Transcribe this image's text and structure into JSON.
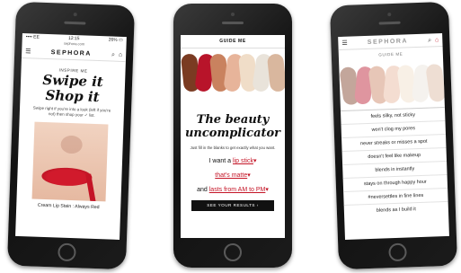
{
  "phone1": {
    "status": {
      "carrier": "•••• EE",
      "time": "12:15",
      "battery": "26% ▭"
    },
    "url": "sephora.com",
    "brand": "SEPHORA",
    "section_title": "INSPIRE ME",
    "title_line1": "Swipe it",
    "title_line2": "Shop it",
    "subtext": "Swipe right if you're into a look (left if you're not) then shop your ✓ list.",
    "product_caption": "Cream Lip Stain : Always Red"
  },
  "phone2": {
    "header": "GUIDE ME",
    "title_line1": "The beauty",
    "title_line2": "uncomplicator",
    "hint": "Just fill in the blanks to get exactly what you want.",
    "line1_prefix": "I want a",
    "line1_blank": "lip stick",
    "line2_blank": "that's matte",
    "line3_prefix": "and",
    "line3_blank": "lasts from AM to PM",
    "arrow": "▾",
    "button_label": "SEE YOUR RESULTS ›",
    "swatch_colors": [
      "#7a3b22",
      "#b8142a",
      "#c9825f",
      "#e7b49a",
      "#f0ddc8",
      "#e9e3da",
      "#d9b79e"
    ]
  },
  "phone3": {
    "brand": "SEPHORA",
    "header": "GUIDE ME",
    "options": [
      "feels silky, not sticky",
      "won't clog my pores",
      "never streaks or misses a spot",
      "doesn't feel like makeup",
      "blends in instantly",
      "stays on through happy hour",
      "#neversettles in fine lines",
      "blends as I build it"
    ]
  },
  "colors": {
    "accent": "#c41426",
    "text": "#111111"
  }
}
